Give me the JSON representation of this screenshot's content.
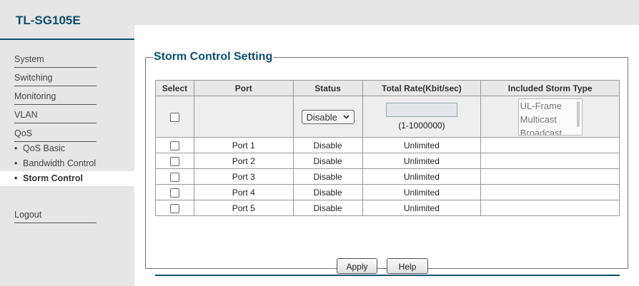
{
  "brand": "TL-SG105E",
  "nav": {
    "system": "System",
    "switching": "Switching",
    "monitoring": "Monitoring",
    "vlan": "VLAN",
    "qos": "QoS",
    "qos_basic": "QoS Basic",
    "bandwidth_control": "Bandwidth Control",
    "storm_control": "Storm Control",
    "logout": "Logout",
    "bullet": "•",
    "active": "storm_control"
  },
  "section": {
    "title": "Storm Control Setting"
  },
  "table": {
    "headers": [
      "Select",
      "Port",
      "Status",
      "Total Rate(Kbit/sec)",
      "Included Storm Type"
    ],
    "config": {
      "status_value": "Disable",
      "rate_value": "",
      "rate_hint": "(1-1000000)",
      "storm_types": [
        "UL-Frame",
        "Multicast",
        "Broadcast"
      ]
    },
    "rows": [
      {
        "port": "Port 1",
        "status": "Disable",
        "rate": "Unlimited",
        "storm_type": ""
      },
      {
        "port": "Port 2",
        "status": "Disable",
        "rate": "Unlimited",
        "storm_type": ""
      },
      {
        "port": "Port 3",
        "status": "Disable",
        "rate": "Unlimited",
        "storm_type": ""
      },
      {
        "port": "Port 4",
        "status": "Disable",
        "rate": "Unlimited",
        "storm_type": ""
      },
      {
        "port": "Port 5",
        "status": "Disable",
        "rate": "Unlimited",
        "storm_type": ""
      }
    ]
  },
  "buttons": {
    "apply": "Apply",
    "help": "Help"
  },
  "colors": {
    "accent": "#0b4f6c",
    "sidebar_bg": "#e6e6e6",
    "header_bg": "#e8e8e8"
  }
}
